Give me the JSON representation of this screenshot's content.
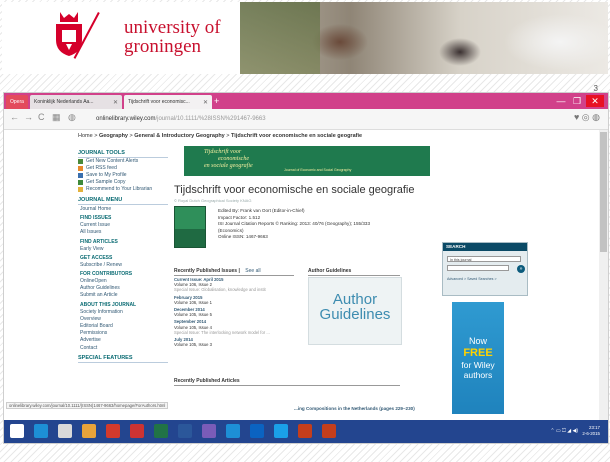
{
  "slide": {
    "university_line1": "university of",
    "university_line2": "groningen",
    "page_number": "3"
  },
  "browser": {
    "tabs": [
      {
        "label": "Opera",
        "active": false
      },
      {
        "label": "Koninklijk Nederlands Aa...",
        "active": false
      },
      {
        "label": "Tijdschrift voor economisc...",
        "active": true
      }
    ],
    "window_controls": [
      "—",
      "❐",
      "✕"
    ],
    "url_host": "onlinelibrary.wiley.com",
    "url_path": "/journal/10.1111/%28ISSN%291467-9663"
  },
  "page": {
    "breadcrumb": [
      "Home",
      "Geography",
      "General & Introductory Geography",
      "Tijdschrift voor economische en sociale geografie"
    ],
    "cover_banner_title": [
      "Tijdschrift voor",
      "economische",
      "en sociale geografie"
    ],
    "cover_banner_sub": "Journal of Economic and Social Geography",
    "journal_title": "Tijdschrift voor economische en sociale geografie",
    "journal_subtitle": "© Royal Dutch Geographical Society KNAG",
    "info": [
      "Edited By: Frank van Oort (Editor-in-Chief)",
      "Impact Factor: 1.512",
      "ISI Journal Citation Reports © Ranking: 2013: 40/76 (Geography); 155/333",
      "(Economics)",
      "Online ISSN: 1467-9663"
    ],
    "recent_issues_label": "Recently Published Issues",
    "see_all_label": "See all",
    "author_guidelines_label": "Author Guidelines",
    "author_guidelines_image_text": [
      "Author",
      "Guidelines"
    ],
    "recent_articles_label": "Recently Published Articles",
    "article_link": "...ing Compositions in the Netherlands (pages 229–230)",
    "issues": [
      {
        "title": "Current Issue: April 2015",
        "line1": "Volume 106, Issue 2",
        "line2": "Special Issue: Globalisation, knowledge and instit"
      },
      {
        "title": "February 2015",
        "line1": "Volume 106, Issue 1",
        "line2": ""
      },
      {
        "title": "December 2014",
        "line1": "Volume 105, Issue 5",
        "line2": ""
      },
      {
        "title": "September 2014",
        "line1": "Volume 105, Issue 4",
        "line2": "Special Issue: The interlocking network model for ..."
      },
      {
        "title": "July 2014",
        "line1": "Volume 105, Issue 3",
        "line2": ""
      }
    ]
  },
  "sidebar": {
    "journal_tools_label": "JOURNAL TOOLS",
    "tools": [
      "Get New Content Alerts",
      "Get RSS feed",
      "Save to My Profile",
      "Get Sample Copy",
      "Recommend to Your Librarian"
    ],
    "journal_menu_label": "JOURNAL MENU",
    "journal_home": "Journal Home",
    "find_issues_label": "FIND ISSUES",
    "find_issues": [
      "Current Issue",
      "All Issues"
    ],
    "find_articles_label": "FIND ARTICLES",
    "find_articles": [
      "Early View"
    ],
    "get_access_label": "GET ACCESS",
    "get_access": [
      "Subscribe / Renew"
    ],
    "for_contributors_label": "FOR CONTRIBUTORS",
    "for_contributors": [
      "OnlineOpen",
      "Author Guidelines",
      "Submit an Article"
    ],
    "about_label": "ABOUT THIS JOURNAL",
    "about": [
      "Society Information",
      "Overview",
      "Editorial Board",
      "Permissions",
      "Advertise",
      "Contact"
    ],
    "special_features_label": "SPECIAL FEATURES"
  },
  "search": {
    "header": "SEARCH",
    "scope": "In this journal",
    "advanced": "Advanced >",
    "saved": "Saved Searches >"
  },
  "ad": {
    "line1": "Now",
    "line2": "FREE",
    "line3": "for Wiley",
    "line4": "authors"
  },
  "status_bar_url": "onlinelibrary.wiley.com/journal/10.1111/(ISSN)1467-9663/homepage/ForAuthors.html",
  "taskbar": {
    "time": "23:17",
    "date": "2-6-2015",
    "tray": "⌃ ▭ ⏍ ◢ ◀)",
    "icon_colors": [
      "#1d8fd6",
      "#d9d9d9",
      "#e8a33a",
      "#d33a2c",
      "#c33",
      "#217346",
      "#2b579a",
      "#7a5cb8",
      "#1d8fd6",
      "#0b63c1",
      "#1aa0e8",
      "#c43e1c",
      "#c43e1c"
    ]
  },
  "colors": {
    "brand_red": "#c8102e",
    "tab_bar": "#d1418a",
    "taskbar": "#23458f",
    "wiley_teal": "#0a6b73"
  }
}
